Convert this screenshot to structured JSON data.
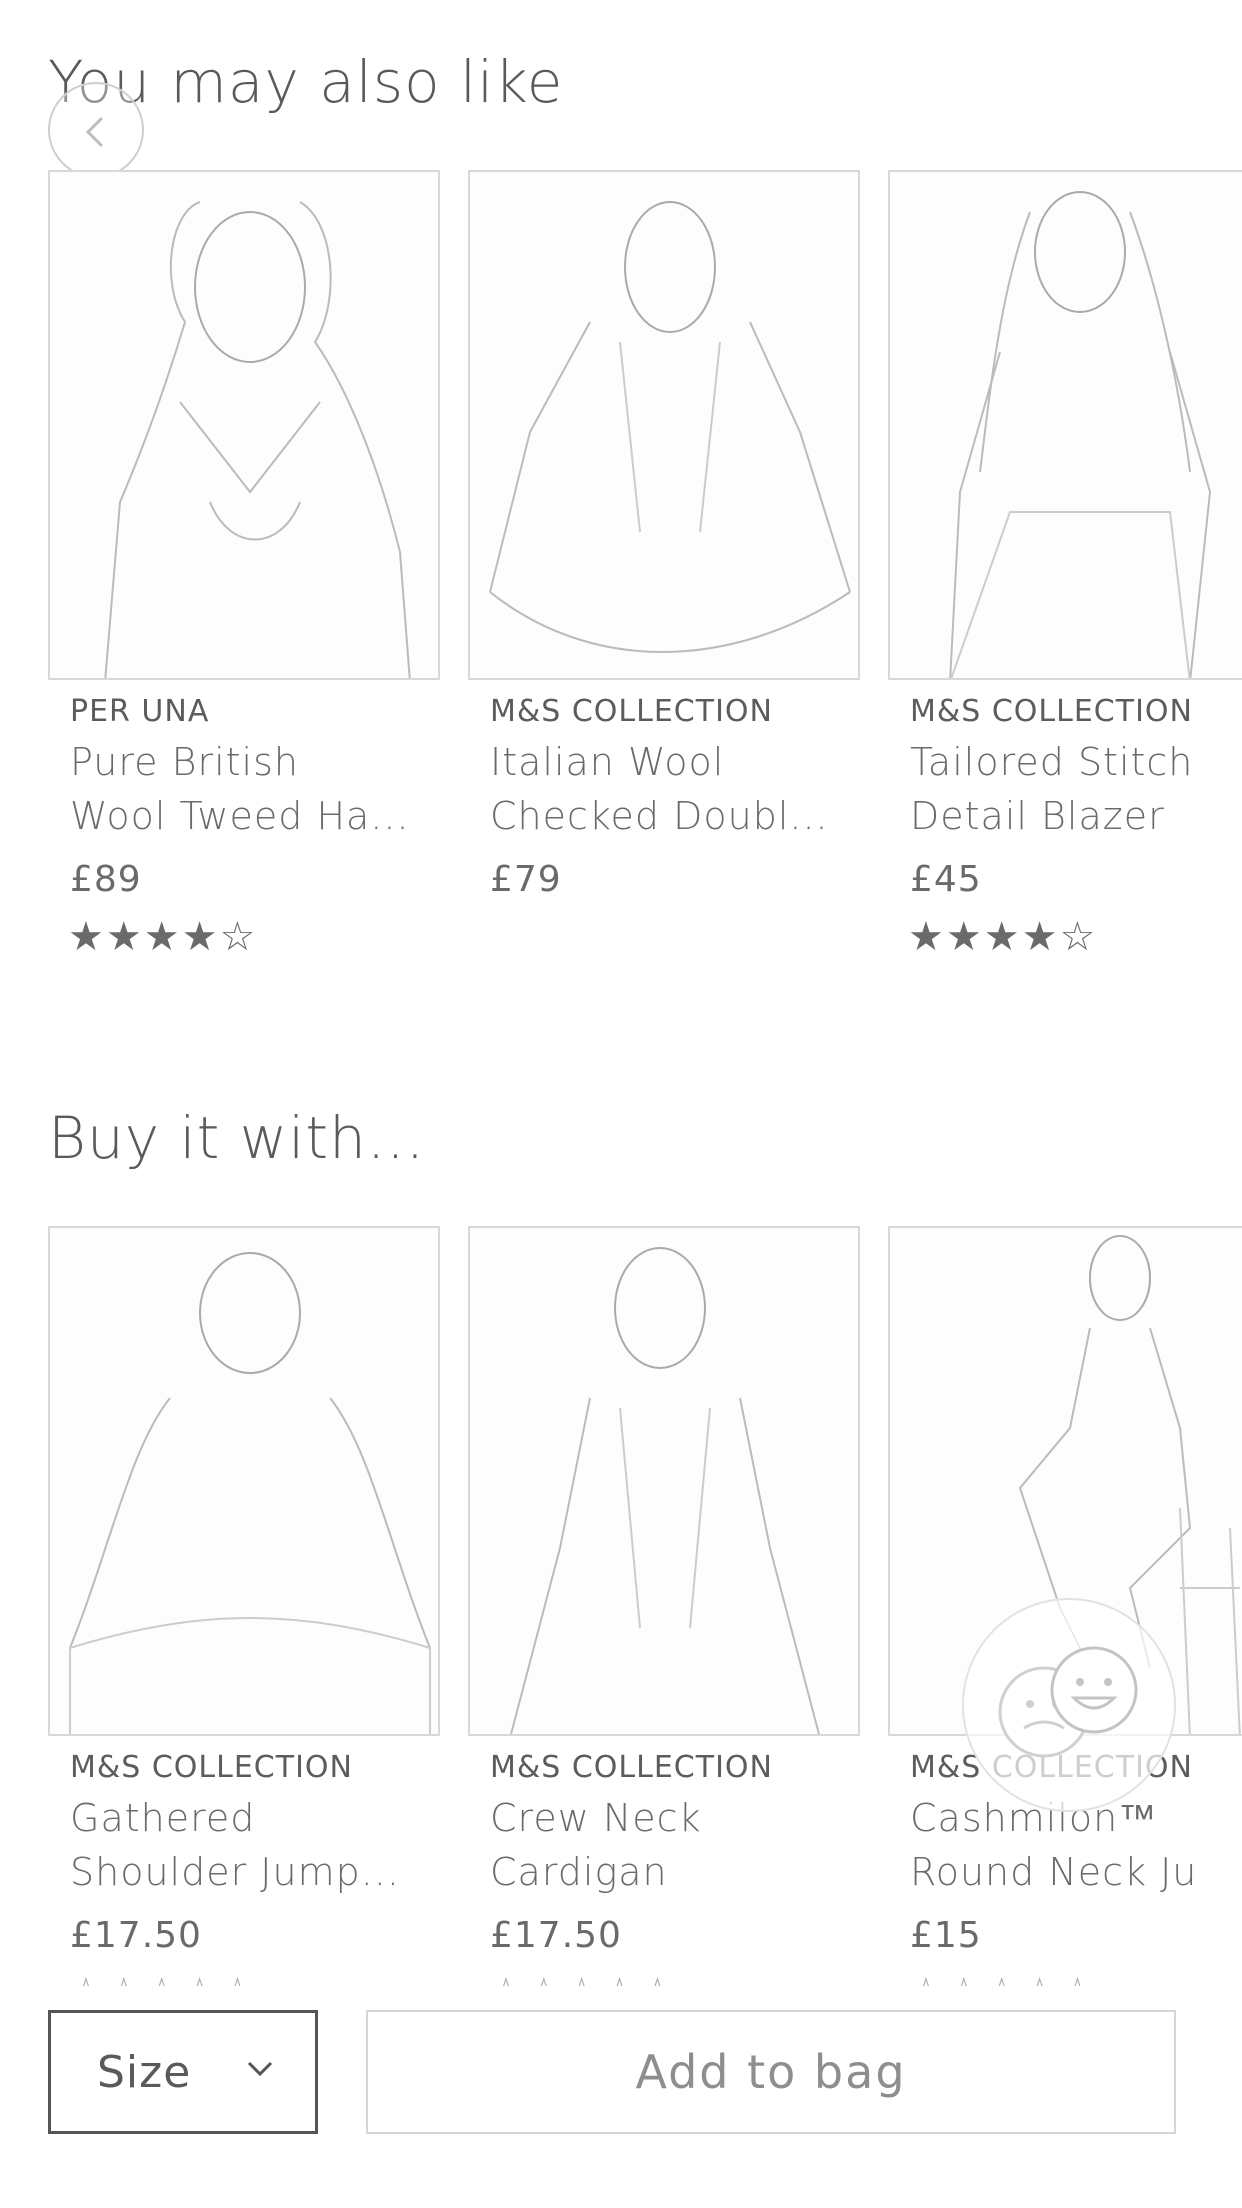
{
  "sections": {
    "you_may_also_like": {
      "title": "You may also like",
      "products": [
        {
          "brand": "PER UNA",
          "name_line1": "Pure British",
          "name_line2": "Wool Tweed Ha...",
          "price": "£89",
          "stars": "★★★★☆"
        },
        {
          "brand": "M&S COLLECTION",
          "name_line1": "Italian Wool",
          "name_line2": "Checked Doubl...",
          "price": "£79",
          "stars": ""
        },
        {
          "brand": "M&S COLLECTION",
          "name_line1": "Tailored Stitch",
          "name_line2": "Detail Blazer",
          "price": "£45",
          "stars": "★★★★☆"
        }
      ]
    },
    "buy_it_with": {
      "title": "Buy it with...",
      "products": [
        {
          "brand": "M&S COLLECTION",
          "name_line1": "Gathered",
          "name_line2": "Shoulder Jump...",
          "price": "£17.50",
          "stars": "☆☆☆☆☆"
        },
        {
          "brand": "M&S COLLECTION",
          "name_line1": "Crew Neck",
          "name_line2": "Cardigan",
          "price": "£17.50",
          "stars": "☆☆☆☆☆"
        },
        {
          "brand": "M&S COLLECTION",
          "name_line1": "Cashmilon™",
          "name_line2": "Round Neck Ju",
          "price": "£15",
          "stars": "☆☆☆☆☆"
        }
      ]
    }
  },
  "bottom_bar": {
    "size_label": "Size",
    "add_to_bag_label": "Add to bag"
  },
  "icons": {
    "back": "chevron-left-icon",
    "size_dropdown": "chevron-down-icon",
    "chat": "chat-faces-icon"
  },
  "colors": {
    "text": "#5a5a5a",
    "border": "#d8d8d8",
    "button_border": "#555555"
  }
}
